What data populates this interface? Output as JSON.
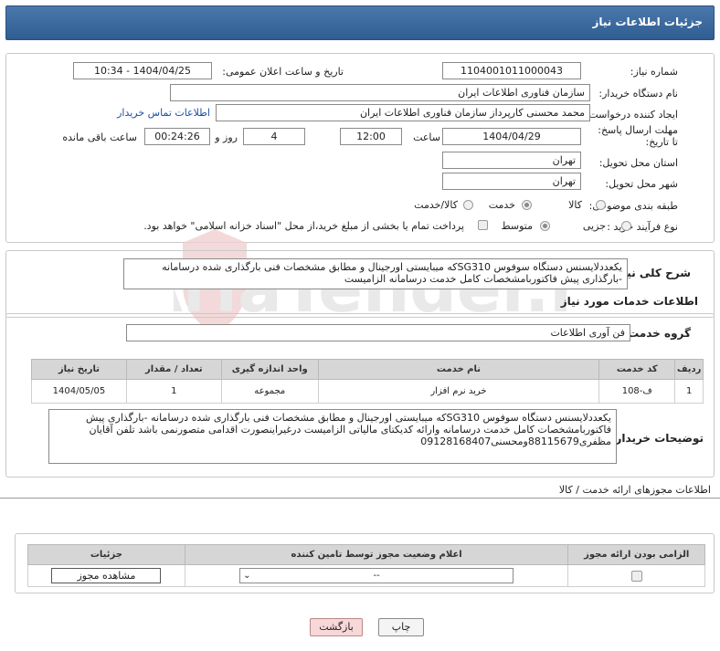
{
  "header": {
    "title": "جزئیات اطلاعات نیاز"
  },
  "form": {
    "need_number_label": "شماره نیاز:",
    "need_number": "1104001011000043",
    "announce_label": "تاریخ و ساعت اعلان عمومی:",
    "announce_value": "1404/04/25 - 10:34",
    "buyer_org_label": "نام دستگاه خریدار:",
    "buyer_org": "سازمان فناوری اطلاعات ایران",
    "creator_label": "ایجاد کننده درخواست:",
    "creator": "محمد محسنی کارپرداز سازمان فناوری اطلاعات ایران",
    "contact_link": "اطلاعات تماس خریدار",
    "deadline_label": "مهلت ارسال پاسخ: تا تاریخ:",
    "deadline_date": "1404/04/29",
    "time_label": "ساعت",
    "deadline_time": "12:00",
    "days_value": "4",
    "days_label": "روز و",
    "remaining_time": "00:24:26",
    "remaining_label": "ساعت باقی مانده",
    "province_label": "استان محل تحویل:",
    "province": "تهران",
    "city_label": "شهر محل تحویل:",
    "city": "تهران",
    "category_label": "طبقه بندی موضوعی:",
    "category_options": [
      "کالا",
      "خدمت",
      "کالا/خدمت"
    ],
    "category_selected": "خدمت",
    "purchase_type_label": "نوع فرآیند خرید :",
    "purchase_options": [
      "جزیی",
      "متوسط"
    ],
    "purchase_selected": "متوسط",
    "treasury_note": "پرداخت تمام یا بخشی از مبلغ خرید،از محل \"اسناد خزانه اسلامی\" خواهد بود."
  },
  "summary": {
    "label": "شرح کلی نیاز:",
    "text": "یکعددلایسنس دستگاه سوفوس SG310که میبایستی اورجینال و مطابق مشخصات فنی بارگذاری شده درسامانه -بارگذاری پیش فاکتوربامشخصات کامل خدمت درسامانه الزامیست"
  },
  "services": {
    "section_title": "اطلاعات خدمات مورد نیاز",
    "group_label": "گروه خدمت:",
    "group_value": "فن آوری اطلاعات",
    "columns": [
      "ردیف",
      "کد خدمت",
      "نام خدمت",
      "واحد اندازه گیری",
      "تعداد / مقدار",
      "تاریخ نیاز"
    ],
    "rows": [
      [
        "1",
        "ف-108",
        "خرید نرم افزار",
        "مجموعه",
        "1",
        "1404/05/05"
      ]
    ]
  },
  "buyer_notes": {
    "label": "توضیحات خریدار:",
    "text": "یکعددلایسنس دستگاه سوفوس SG310که میبایستی اورجینال و مطابق مشخصات فنی بارگذاری شده درسامانه -بارگذاری پیش فاکتوربامشخصات کامل خدمت درسامانه وارائه کدیکتای مالیاتی الزامیست درغیراینصورت اقدامی متصورنمی باشد تلفن آقایان مظفری88115679ومحسنی09128168407"
  },
  "permits": {
    "section_title": "اطلاعات مجوزهای ارائه خدمت / کالا",
    "columns": [
      "الزامی بودن ارائه مجوز",
      "اعلام وضعیت مجوز توسط تامین کننده",
      "جزئیات"
    ],
    "select_value": "--",
    "view_button": "مشاهده مجوز"
  },
  "footer": {
    "print_button": "چاپ",
    "back_button": "بازگشت"
  },
  "colors": {
    "header_bg": "#3b68a0",
    "back_button_bg": "#f7d7d7",
    "link": "#1f4fa3"
  }
}
